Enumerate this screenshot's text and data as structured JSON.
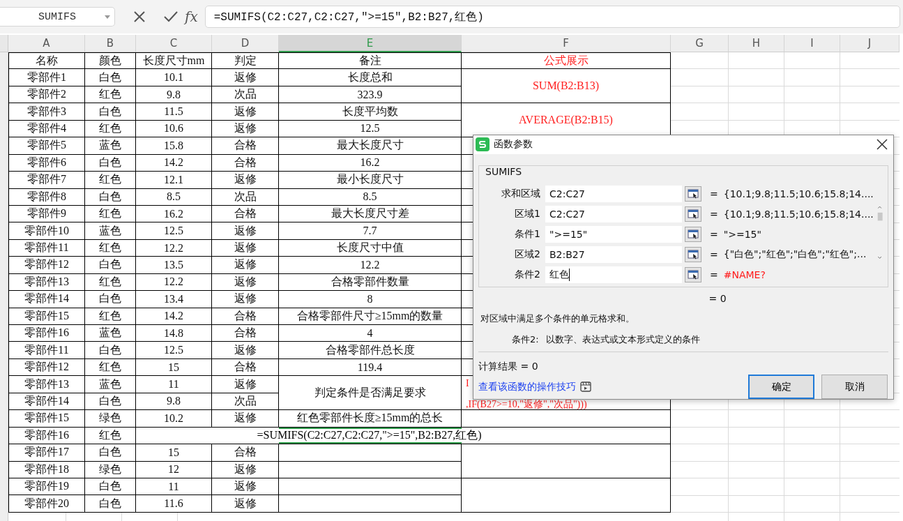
{
  "formula_bar": {
    "name_box": "SUMIFS",
    "fx": "fx",
    "formula": "=SUMIFS(C2:C27,C2:C27,\">=15\",B2:B27,红色)"
  },
  "columns": [
    {
      "label": "A",
      "selected": false
    },
    {
      "label": "B",
      "selected": false
    },
    {
      "label": "C",
      "selected": false
    },
    {
      "label": "D",
      "selected": false
    },
    {
      "label": "E",
      "selected": true
    },
    {
      "label": "F",
      "selected": false
    },
    {
      "label": "G",
      "selected": false
    },
    {
      "label": "H",
      "selected": false
    },
    {
      "label": "I",
      "selected": false
    },
    {
      "label": "J",
      "selected": false
    }
  ],
  "rows": [
    {
      "a": "名称",
      "b": "颜色",
      "c": "长度尺寸mm",
      "d": "判定",
      "e": "备注",
      "f": "公式展示"
    },
    {
      "a": "零部件1",
      "b": "白色",
      "c": "10.1",
      "d": "返修",
      "e": "长度总和",
      "f": "SUM(B2:B13)",
      "f_merged": true
    },
    {
      "a": "零部件2",
      "b": "红色",
      "c": "9.8",
      "d": "次品",
      "e": "323.9"
    },
    {
      "a": "零部件3",
      "b": "白色",
      "c": "11.5",
      "d": "返修",
      "e": "长度平均数",
      "f": "AVERAGE(B2:B15)",
      "f_merged": true
    },
    {
      "a": "零部件4",
      "b": "红色",
      "c": "10.6",
      "d": "返修",
      "e": "12.5"
    },
    {
      "a": "零部件5",
      "b": "蓝色",
      "c": "15.8",
      "d": "合格",
      "e": "最大长度尺寸"
    },
    {
      "a": "零部件6",
      "b": "白色",
      "c": "14.2",
      "d": "合格",
      "e": "16.2"
    },
    {
      "a": "零部件7",
      "b": "红色",
      "c": "12.1",
      "d": "返修",
      "e": "最小长度尺寸"
    },
    {
      "a": "零部件8",
      "b": "白色",
      "c": "8.5",
      "d": "次品",
      "e": "8.5"
    },
    {
      "a": "零部件9",
      "b": "红色",
      "c": "16.2",
      "d": "合格",
      "e": "最大长度尺寸差"
    },
    {
      "a": "零部件10",
      "b": "蓝色",
      "c": "12.5",
      "d": "返修",
      "e": "7.7"
    },
    {
      "a": "零部件11",
      "b": "红色",
      "c": "12.2",
      "d": "返修",
      "e": "长度尺寸中值"
    },
    {
      "a": "零部件12",
      "b": "白色",
      "c": "13.5",
      "d": "返修",
      "e": "12.2"
    },
    {
      "a": "零部件13",
      "b": "红色",
      "c": "12.2",
      "d": "返修",
      "e": "合格零部件数量"
    },
    {
      "a": "零部件14",
      "b": "白色",
      "c": "13.4",
      "d": "返修",
      "e": "8"
    },
    {
      "a": "零部件15",
      "b": "红色",
      "c": "14.2",
      "d": "合格",
      "e": "合格零部件尺寸≥15mm的数量"
    },
    {
      "a": "零部件16",
      "b": "蓝色",
      "c": "14.8",
      "d": "合格",
      "e": "4"
    },
    {
      "a": "零部件11",
      "b": "白色",
      "c": "12.5",
      "d": "返修",
      "e": "合格零部件总长度"
    },
    {
      "a": "零部件12",
      "b": "红色",
      "c": "15",
      "d": "合格",
      "e": "119.4"
    },
    {
      "a": "零部件13",
      "b": "蓝色",
      "c": "11",
      "d": "返修",
      "e": "判定条件是否满足要求",
      "e_merged": true,
      "f_lines": [
        "I",
        ",IF(B27>=10,\"返修\",\"次品\")))"
      ],
      "f_merged": true
    },
    {
      "a": "零部件14",
      "b": "白色",
      "c": "9.8",
      "d": "次品"
    },
    {
      "a": "零部件15",
      "b": "绿色",
      "c": "10.2",
      "d": "返修",
      "e": "红色零部件长度≥15mm的总长"
    },
    {
      "a": "零部件16",
      "b": "红色",
      "formula_overflow": "=SUMIFS(C2:C27,C2:C27,\">=15\",B2:B27,红色)"
    },
    {
      "a": "零部件17",
      "b": "白色",
      "c": "15",
      "d": "合格",
      "f_merged": true
    },
    {
      "a": "零部件18",
      "b": "绿色",
      "c": "12",
      "d": "返修"
    },
    {
      "a": "零部件19",
      "b": "白色",
      "c": "11",
      "d": "返修",
      "f_merged": true
    },
    {
      "a": "零部件20",
      "b": "白色",
      "c": "11.6",
      "d": "返修"
    }
  ],
  "dialog": {
    "title": "函数参数",
    "function": "SUMIFS",
    "params": [
      {
        "label": "求和区域",
        "value": "C2:C27",
        "eq": "=",
        "result": "{10.1;9.8;11.5;10.6;15.8;14....",
        "error": false,
        "focused": false
      },
      {
        "label": "区域1",
        "value": "C2:C27",
        "eq": "=",
        "result": "{10.1;9.8;11.5;10.6;15.8;14....",
        "error": false,
        "focused": false
      },
      {
        "label": "条件1",
        "value": "\">=15\"",
        "eq": "=",
        "result": "\">=15\"",
        "error": false,
        "focused": false
      },
      {
        "label": "区域2",
        "value": "B2:B27",
        "eq": "=",
        "result": "{\"白色\";\"红色\";\"白色\";\"红色\";...",
        "error": false,
        "focused": false
      },
      {
        "label": "条件2",
        "value": "红色",
        "eq": "=",
        "result": "#NAME?",
        "error": true,
        "focused": true
      }
    ],
    "formula_result": "= 0",
    "description": "对区域中满足多个条件的单元格求和。",
    "param_help": {
      "label": "条件2:",
      "text": "以数字、表达式或文本形式定义的条件"
    },
    "calc_result": "计算结果 = 0",
    "help_link": "查看该函数的操作技巧",
    "buttons": [
      {
        "label": "确定",
        "default": true
      },
      {
        "label": "取消",
        "default": false
      }
    ]
  }
}
